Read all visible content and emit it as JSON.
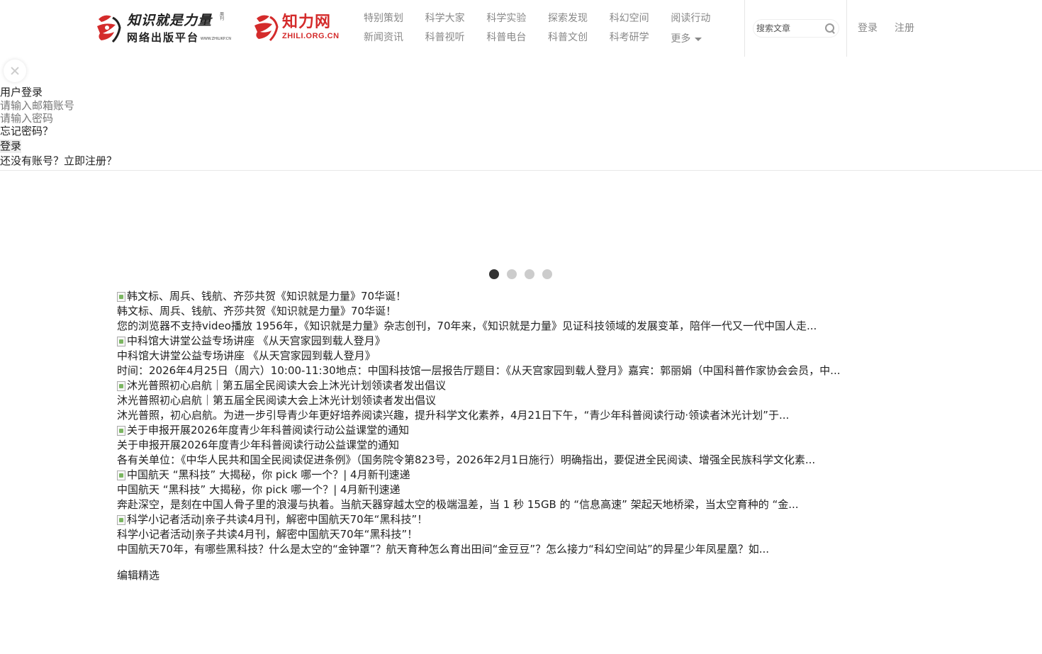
{
  "header": {
    "logo1": {
      "line1": "知识就是力量",
      "line2": "网络出版平台",
      "small": "WWW.ZHILIKP.CN",
      "vertical": "周刊"
    },
    "logo2": {
      "line1": "知力网",
      "line2": "ZHILI.ORG.CN"
    },
    "nav_row1": [
      "特别策划",
      "科学大家",
      "科学实验",
      "探索发现",
      "科幻空间",
      "阅读行动"
    ],
    "nav_row2": [
      "新闻资讯",
      "科普视听",
      "科普电台",
      "科普文创",
      "科考研学",
      "更多"
    ],
    "search_placeholder": "搜索文章",
    "login_link": "登录",
    "register_link": "注册"
  },
  "login_panel": {
    "title": "用户登录",
    "email_placeholder": "请输入邮箱账号",
    "password_placeholder": "请输入密码",
    "forgot": "忘记密码？",
    "submit": "登录",
    "no_account": "还没有账号？立即注册？"
  },
  "carousel": {
    "dot_count": 4,
    "active_index": 0
  },
  "articles": [
    {
      "img_alt": "韩文标、周兵、钱航、齐莎共贺《知识就是力量》70华诞！",
      "title": "韩文标、周兵、钱航、齐莎共贺《知识就是力量》70华诞！",
      "summary": "您的浏览器不支持video播放 1956年，《知识就是力量》杂志创刊，70年来，《知识就是力量》见证科技领域的发展变革，陪伴一代又一代中国人走..."
    },
    {
      "img_alt": "中科馆大讲堂公益专场讲座 《从天宫家园到载人登月》",
      "title": "中科馆大讲堂公益专场讲座 《从天宫家园到载人登月》",
      "summary": "时间：2026年4月25日（周六）10:00-11:30地点：中国科技馆一层报告厅题目：《从天宫家园到载人登月》嘉宾：郭丽娟（中国科普作家协会会员，中..."
    },
    {
      "img_alt": "沐光普照初心启航｜第五届全民阅读大会上沐光计划领读者发出倡议",
      "title": "沐光普照初心启航｜第五届全民阅读大会上沐光计划领读者发出倡议",
      "summary": "沐光普照，初心启航。为进一步引导青少年更好培养阅读兴趣，提升科学文化素养，4月21日下午，“青少年科普阅读行动·领读者沐光计划”于..."
    },
    {
      "img_alt": "关于申报开展2026年度青少年科普阅读行动公益课堂的通知",
      "title": "关于申报开展2026年度青少年科普阅读行动公益课堂的通知",
      "summary": "各有关单位：《中华人民共和国全民阅读促进条例》（国务院令第823号，2026年2月1日施行）明确指出，要促进全民阅读、增强全民族科学文化素..."
    },
    {
      "img_alt": "中国航天 “黑科技” 大揭秘，你 pick 哪一个？| 4月新刊速递",
      "title": "中国航天 “黑科技” 大揭秘，你 pick 哪一个？| 4月新刊速递",
      "summary": "奔赴深空，是刻在中国人骨子里的浪漫与执着。当航天器穿越太空的极端温差，当 1 秒 15GB 的 “信息高速” 架起天地桥梁，当太空育种的 “金..."
    },
    {
      "img_alt": "科学小记者活动|亲子共读4月刊，解密中国航天70年“黑科技”！",
      "title": "科学小记者活动|亲子共读4月刊，解密中国航天70年“黑科技”！",
      "summary": "中国航天70年，有哪些黑科技？什么是太空的“金钟罩”？航天育种怎么育出田间“金豆豆”？怎么接力“科幻空间站”的异星少年凤星凰？如..."
    }
  ],
  "editor_pick": "编辑精选",
  "colors": {
    "brand_red": "#d42b2b",
    "nav_gray": "#888888",
    "active_dot": "#333333",
    "dot": "#cccccc"
  }
}
